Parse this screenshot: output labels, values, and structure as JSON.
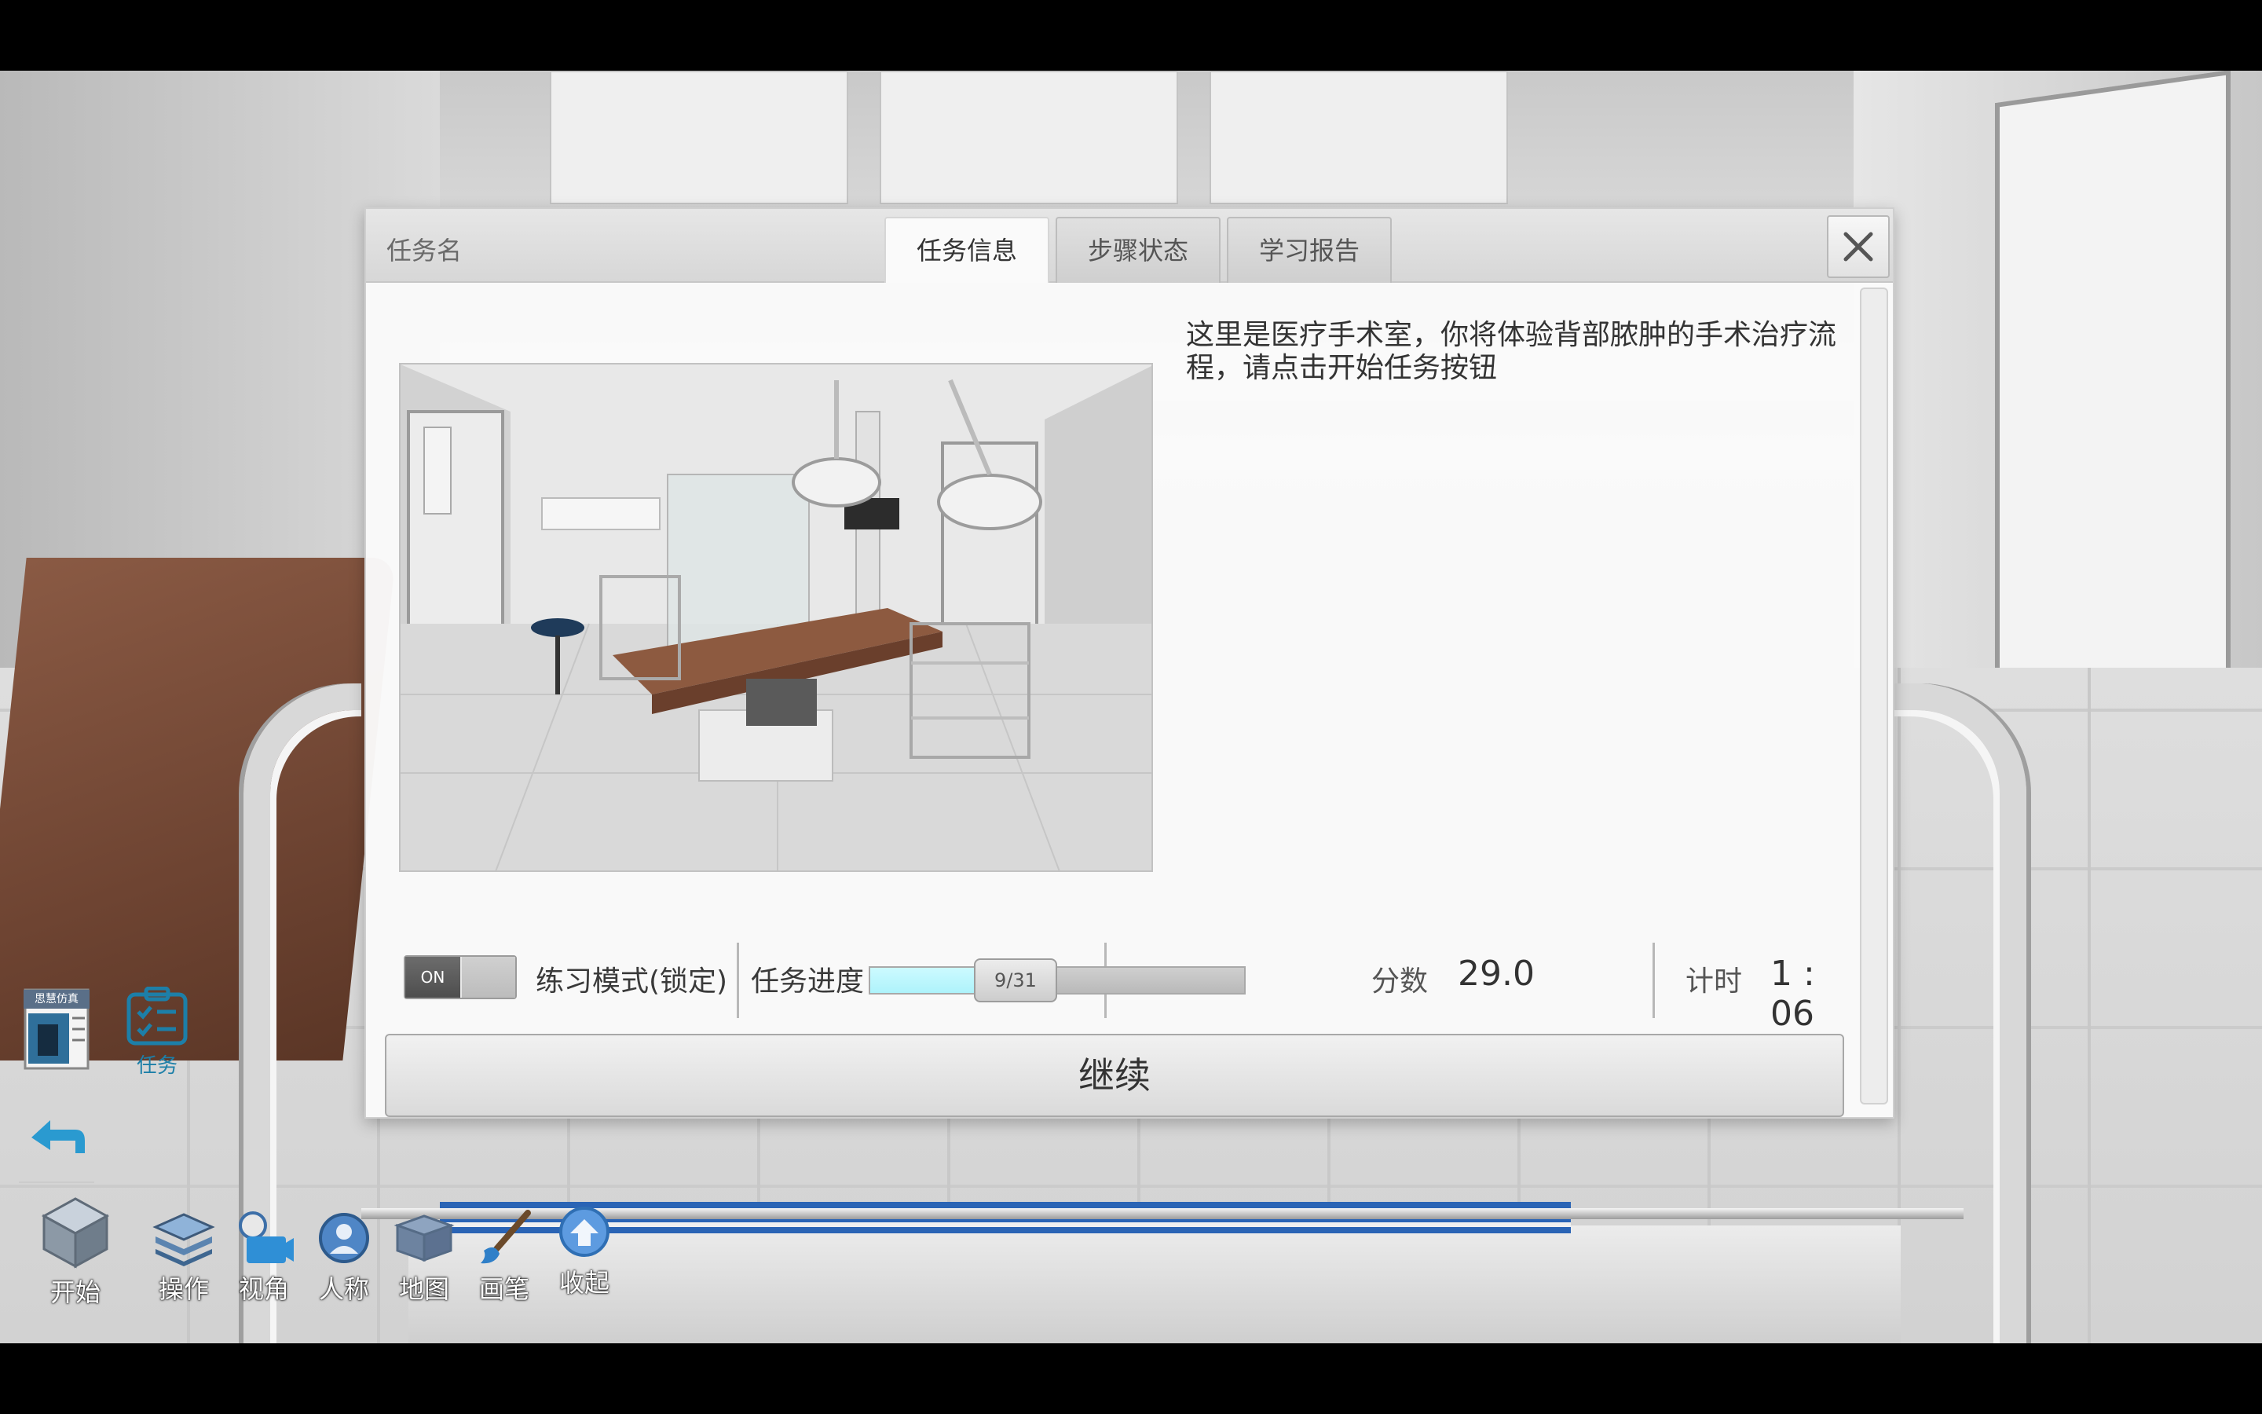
{
  "dialog": {
    "title": "任务名",
    "tabs": [
      {
        "label": "任务信息",
        "active": true
      },
      {
        "label": "步骤状态",
        "active": false
      },
      {
        "label": "学习报告",
        "active": false
      }
    ],
    "description": "这里是医疗手术室，你将体验背部脓肿的手术治疗流程，请点击开始任务按钮",
    "status": {
      "toggle_on_label": "ON",
      "mode_label": "练习模式(锁定)",
      "progress_label": "任务进度",
      "progress_text": "9/31",
      "progress_fraction": 0.29,
      "score_label": "分数",
      "score_value": "29.0",
      "timer_label": "计时",
      "timer_value": "1 : 06"
    },
    "continue_label": "继续"
  },
  "side": {
    "task_label": "任务",
    "badge_text": "思慧仿真"
  },
  "toolbar": [
    {
      "label": "开始",
      "icon": "cube-icon"
    },
    {
      "label": "操作",
      "icon": "layers-icon"
    },
    {
      "label": "视角",
      "icon": "camera-icon"
    },
    {
      "label": "人称",
      "icon": "person-icon"
    },
    {
      "label": "地图",
      "icon": "map-icon"
    },
    {
      "label": "画笔",
      "icon": "brush-icon"
    },
    {
      "label": "收起",
      "icon": "collapse-icon"
    }
  ],
  "colors": {
    "progress_fill": "#aef3fb",
    "accent_blue": "#2a64b5",
    "task_icon": "#1d7fa8"
  }
}
